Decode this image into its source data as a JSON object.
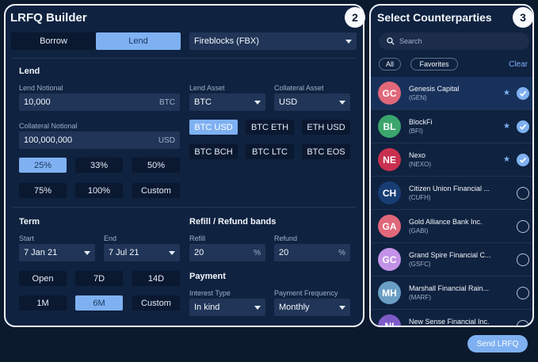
{
  "builder": {
    "title": "LRFQ Builder",
    "badge": "2",
    "side_tabs": {
      "borrow": "Borrow",
      "lend": "Lend",
      "selected": "Lend"
    },
    "venue": "Fireblocks (FBX)",
    "lend": {
      "heading": "Lend",
      "notional_label": "Lend Notional",
      "notional_value": "10,000",
      "notional_unit": "BTC",
      "collateral_label": "Collateral Notional",
      "collateral_value": "100,000,000",
      "collateral_unit": "USD",
      "pct_buttons": [
        "25%",
        "33%",
        "50%",
        "75%",
        "100%",
        "Custom"
      ],
      "pct_selected": "25%",
      "lend_asset_label": "Lend Asset",
      "lend_asset_value": "BTC",
      "collateral_asset_label": "Collateral Asset",
      "collateral_asset_value": "USD",
      "pairs": [
        "BTC USD",
        "BTC ETH",
        "ETH USD",
        "BTC BCH",
        "BTC LTC",
        "BTC EOS"
      ],
      "pair_selected": "BTC USD"
    },
    "term": {
      "heading": "Term",
      "start_label": "Start",
      "start_value": "7 Jan 21",
      "end_label": "End",
      "end_value": "7 Jul 21",
      "buttons": [
        "Open",
        "7D",
        "14D",
        "1M",
        "6M",
        "Custom"
      ],
      "selected": "6M"
    },
    "refill": {
      "heading": "Refill / Refund bands",
      "refill_label": "Refill",
      "refill_value": "20",
      "refund_label": "Refund",
      "refund_value": "20",
      "unit": "%"
    },
    "payment": {
      "heading": "Payment",
      "interest_label": "Interest Type",
      "interest_value": "In kind",
      "frequency_label": "Payment Frequency",
      "frequency_value": "Monthly"
    }
  },
  "counterparties": {
    "title": "Select Counterparties",
    "badge": "3",
    "search_placeholder": "Search",
    "filters": [
      "All",
      "Favorites"
    ],
    "clear_label": "Clear",
    "items": [
      {
        "initials": "GC",
        "name": "Genesis Capital",
        "code": "(GEN)",
        "color": "#e0687a",
        "favorite": true,
        "selected": true,
        "highlight": true
      },
      {
        "initials": "BL",
        "name": "BlockFi",
        "code": "(BFI)",
        "color": "#3aa56c",
        "favorite": true,
        "selected": true,
        "highlight": false
      },
      {
        "initials": "NE",
        "name": "Nexo",
        "code": "(NEXO)",
        "color": "#c8304f",
        "favorite": true,
        "selected": true,
        "highlight": false
      },
      {
        "initials": "CH",
        "name": "Citizen Union Financial ...",
        "code": "(CUFH)",
        "color": "#173d73",
        "favorite": false,
        "selected": false,
        "highlight": false
      },
      {
        "initials": "GA",
        "name": "Gold Alliance Bank Inc.",
        "code": "(GABI)",
        "color": "#e0687a",
        "favorite": false,
        "selected": false,
        "highlight": false
      },
      {
        "initials": "GC",
        "name": "Grand Spire Financial C...",
        "code": "(GSFC)",
        "color": "#c392e8",
        "favorite": false,
        "selected": false,
        "highlight": false
      },
      {
        "initials": "MH",
        "name": "Marshall Financial Rain...",
        "code": "(MARF)",
        "color": "#6a9ec4",
        "favorite": false,
        "selected": false,
        "highlight": false
      },
      {
        "initials": "NI",
        "name": "New Sense Financial Inc.",
        "code": "",
        "color": "#7d5bc7",
        "favorite": false,
        "selected": false,
        "highlight": false
      }
    ]
  },
  "send_label": "Send LRFQ"
}
